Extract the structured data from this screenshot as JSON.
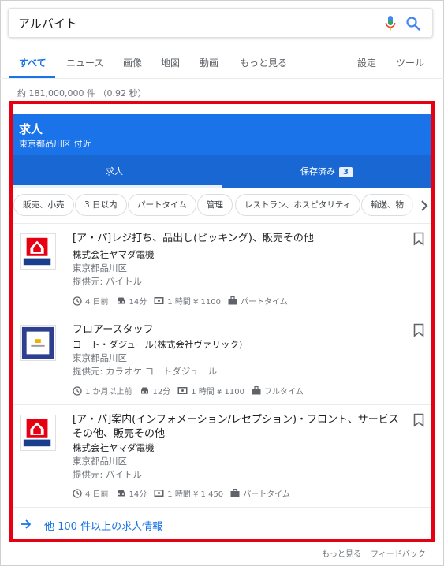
{
  "search": {
    "query": "アルバイト"
  },
  "tabs": [
    {
      "label": "すべて",
      "active": true
    },
    {
      "label": "ニュース"
    },
    {
      "label": "画像"
    },
    {
      "label": "地図"
    },
    {
      "label": "動画"
    },
    {
      "label": "もっと見る"
    },
    {
      "label": "設定"
    },
    {
      "label": "ツール"
    }
  ],
  "result_count": "約 181,000,000 件 （0.92 秒）",
  "jobs": {
    "title": "求人",
    "location": "東京都品川区 付近",
    "tab_jobs": "求人",
    "tab_saved": "保存済み",
    "saved_count": "3",
    "chips": [
      "販売、小売",
      "3 日以内",
      "パートタイム",
      "管理",
      "レストラン、ホスピタリティ",
      "輸送、物"
    ],
    "listings": [
      {
        "title": "[ア・パ]レジ打ち、品出し(ピッキング)、販売その他",
        "company": "株式会社ヤマダ電機",
        "location": "東京都品川区",
        "via": "提供元: バイトル",
        "posted": "4 日前",
        "commute": "14分",
        "wage": "1 時間 ¥ 1100",
        "type": "パートタイム",
        "logo": "yamada"
      },
      {
        "title": "フロアースタッフ",
        "company": "コート・ダジュール(株式会社ヴァリック)",
        "location": "東京都品川区",
        "via": "提供元: カラオケ コートダジュール",
        "posted": "1 か月以上前",
        "commute": "12分",
        "wage": "1 時間 ¥ 1100",
        "type": "フルタイム",
        "logo": "cote"
      },
      {
        "title": "[ア・パ]案内(インフォメーション/レセプション)・フロント、サービスその他、販売その他",
        "company": "株式会社ヤマダ電機",
        "location": "東京都品川区",
        "via": "提供元: バイトル",
        "posted": "4 日前",
        "commute": "14分",
        "wage": "1 時間 ¥ 1,450",
        "type": "パートタイム",
        "logo": "yamada"
      }
    ],
    "more_link": "他 100 件以上の求人情報"
  },
  "footer": {
    "more": "もっと見る",
    "feedback": "フィードバック"
  },
  "colors": {
    "accent": "#1a73e8",
    "header_blue": "#1a73e8",
    "tab_blue": "#1967d2",
    "highlight_red": "#e60012",
    "yamada_red": "#e60012"
  }
}
